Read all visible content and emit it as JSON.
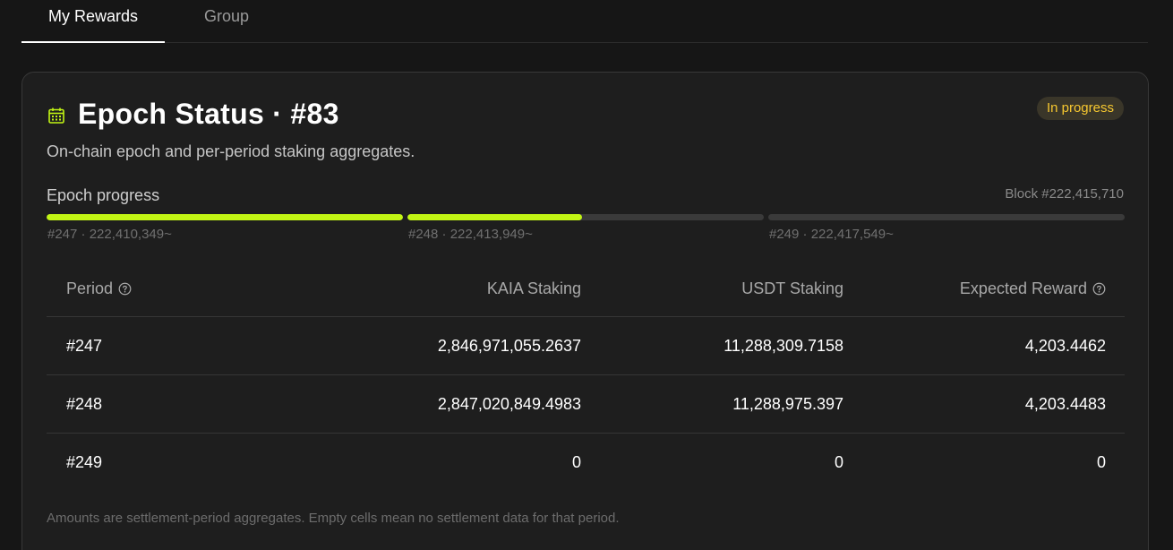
{
  "tabs": [
    {
      "label": "My Rewards",
      "active": true
    },
    {
      "label": "Group",
      "active": false
    }
  ],
  "card": {
    "icon": "calendar-icon",
    "title": "Epoch Status · #83",
    "badge": "In progress",
    "subtitle": "On-chain epoch and per-period staking aggregates.",
    "progress": {
      "label": "Epoch progress",
      "block": "Block #222,415,710",
      "segments": [
        {
          "caption": "#247 · 222,410,349~",
          "fraction": 1.0
        },
        {
          "caption": "#248 · 222,413,949~",
          "fraction": 0.49
        },
        {
          "caption": "#249 · 222,417,549~",
          "fraction": 0.0
        }
      ]
    },
    "table": {
      "columns": [
        "Period",
        "KAIA Staking",
        "USDT Staking",
        "Expected Reward"
      ],
      "rows": [
        [
          "#247",
          "2,846,971,055.2637",
          "11,288,309.7158",
          "4,203.4462"
        ],
        [
          "#248",
          "2,847,020,849.4983",
          "11,288,975.397",
          "4,203.4483"
        ],
        [
          "#249",
          "0",
          "0",
          "0"
        ]
      ]
    },
    "footnote": "Amounts are settlement-period aggregates. Empty cells mean no settlement data for that period."
  },
  "colors": {
    "accent": "#c2f514",
    "badge_text": "#f7c830",
    "background": "#161616",
    "card": "#1e1e1e"
  }
}
